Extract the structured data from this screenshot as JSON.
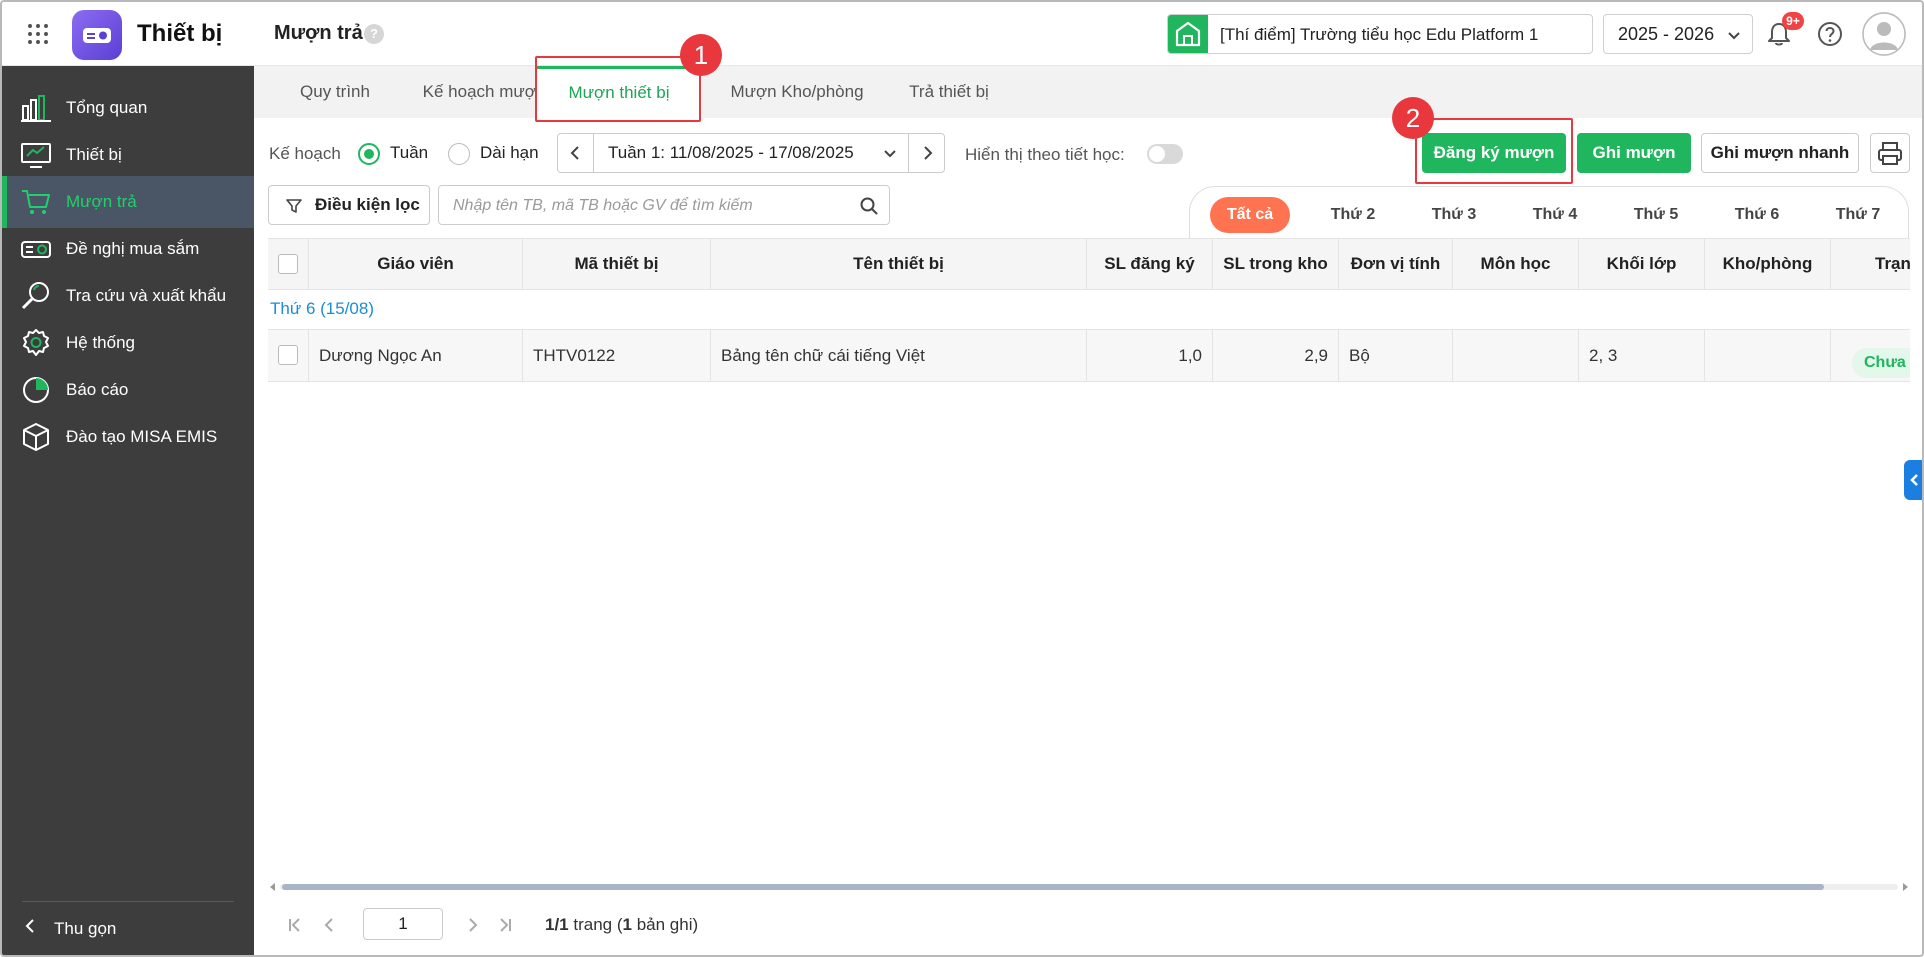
{
  "app": {
    "title": "Thiết bị",
    "page_title": "Mượn trả",
    "help_mark": "?"
  },
  "header": {
    "school": "[Thí điểm] Trường tiểu học Edu Platform 1",
    "year": "2025 - 2026",
    "notification_badge": "9+"
  },
  "sidebar": {
    "items": [
      {
        "label": "Tổng quan",
        "icon": "chart-bars-icon"
      },
      {
        "label": "Thiết bị",
        "icon": "monitor-icon"
      },
      {
        "label": "Mượn trả",
        "icon": "cart-icon",
        "active": true
      },
      {
        "label": "Đề nghị mua sắm",
        "icon": "projector-icon"
      },
      {
        "label": "Tra cứu và xuất khẩu",
        "icon": "magnifier-icon"
      },
      {
        "label": "Hệ thống",
        "icon": "gear-icon"
      },
      {
        "label": "Báo cáo",
        "icon": "pie-chart-icon"
      },
      {
        "label": "Đào tạo MISA EMIS",
        "icon": "box-icon"
      }
    ],
    "collapse_label": "Thu gọn"
  },
  "tabs": [
    {
      "label": "Quy trình"
    },
    {
      "label": "Kế hoạch mượn"
    },
    {
      "label": "Mượn thiết bị",
      "active": true
    },
    {
      "label": "Mượn Kho/phòng"
    },
    {
      "label": "Trả thiết bị"
    }
  ],
  "annotations": {
    "one": "1",
    "two": "2"
  },
  "toolbar": {
    "plan_label": "Kế hoạch",
    "week_option": "Tuần",
    "long_option": "Dài hạn",
    "week_range": "Tuần 1: 11/08/2025 - 17/08/2025",
    "period_toggle_label": "Hiển thị theo tiết học:",
    "register_button": "Đăng ký mượn",
    "record_button": "Ghi mượn",
    "quick_record_button": "Ghi mượn nhanh"
  },
  "filter": {
    "button": "Điều kiện lọc",
    "search_placeholder": "Nhập tên TB, mã TB hoặc GV để tìm kiếm"
  },
  "day_tabs": [
    "Tất cả",
    "Thứ 2",
    "Thứ 3",
    "Thứ 4",
    "Thứ 5",
    "Thứ 6",
    "Thứ 7"
  ],
  "table": {
    "columns": [
      "Giáo viên",
      "Mã thiết bị",
      "Tên thiết bị",
      "SL đăng ký",
      "SL trong kho",
      "Đơn vị tính",
      "Môn học",
      "Khối lớp",
      "Kho/phòng",
      "Trạng thái"
    ],
    "group_label": "Thứ 6 (15/08)",
    "rows": [
      {
        "teacher": "Dương Ngọc An",
        "code": "THTV0122",
        "name": "Bảng tên chữ cái tiếng Việt",
        "qty_registered": "1,0",
        "qty_in_stock": "2,9",
        "unit": "Bộ",
        "subject": "",
        "grade": "2, 3",
        "room": "",
        "status": "Chưa mượn"
      }
    ]
  },
  "pagination": {
    "current": "1",
    "pages": "1/1",
    "trang": "trang (",
    "records": "1",
    "records_suffix": "bản ghi)"
  },
  "colors": {
    "accent": "#1fb65e",
    "sidebar": "#3d3d3d",
    "annotation": "#e8383d",
    "day_active": "#ff7350",
    "group_text": "#1a8dd8"
  }
}
